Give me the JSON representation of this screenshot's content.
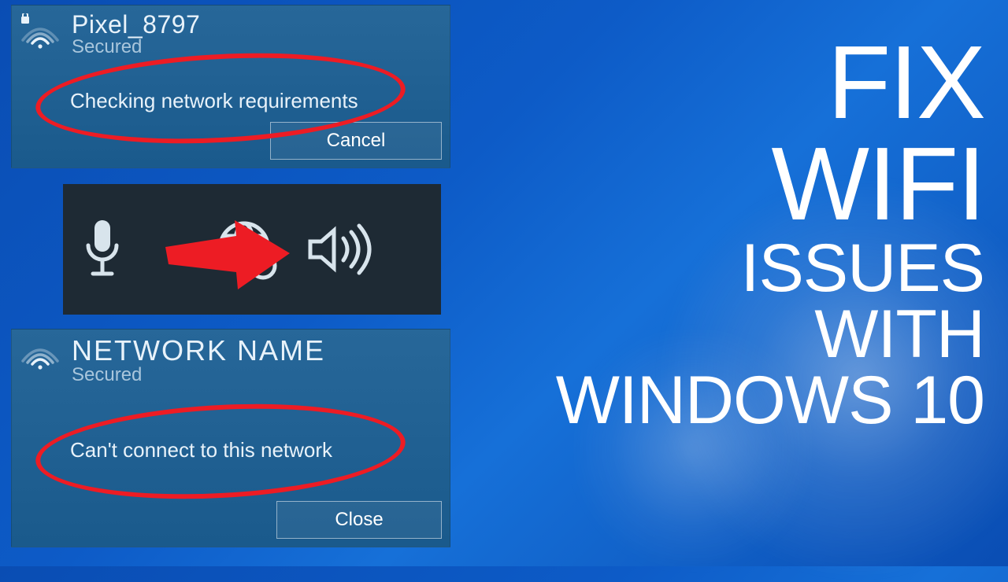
{
  "title": {
    "line1": "FIX",
    "line2": "WIFI",
    "line3": "ISSUES",
    "line4": "WITH",
    "line5": "WINDOWS 10"
  },
  "panel1": {
    "network_name": "Pixel_8797",
    "security": "Secured",
    "status": "Checking network requirements",
    "button": "Cancel"
  },
  "panel2": {
    "network_name": "NETWORK NAME",
    "security": "Secured",
    "status": "Can't connect to this network",
    "button": "Close"
  },
  "tray": {
    "icons": [
      "microphone-icon",
      "network-no-internet-icon",
      "volume-icon"
    ]
  }
}
